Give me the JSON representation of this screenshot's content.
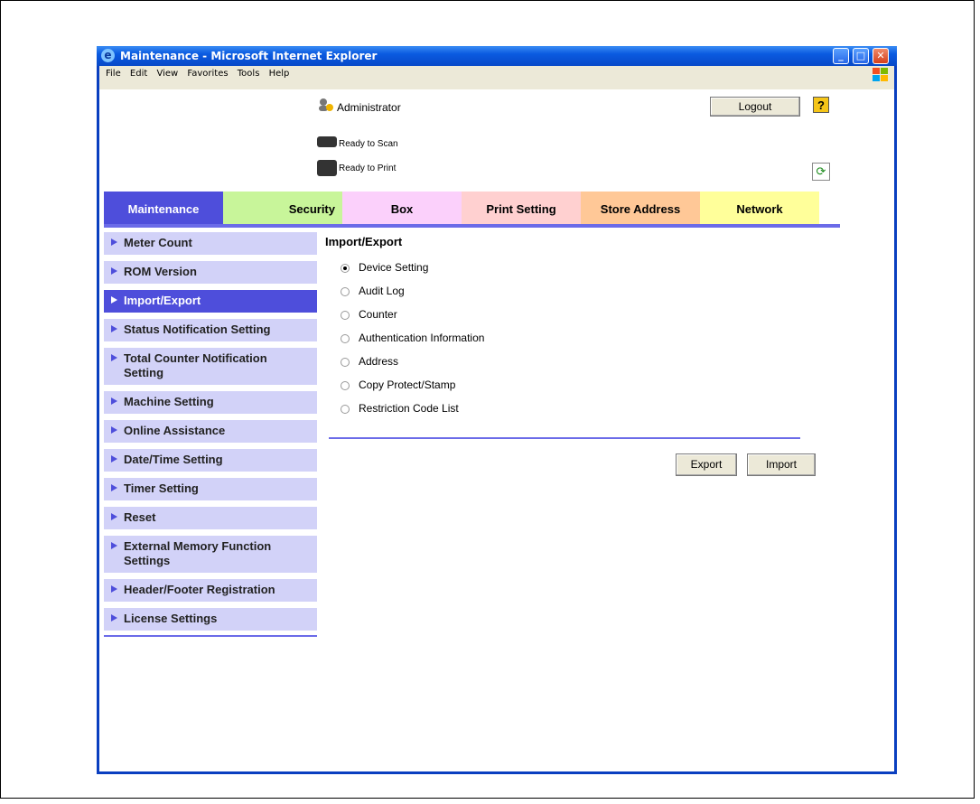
{
  "window": {
    "title": "Maintenance - Microsoft Internet Explorer"
  },
  "menu": [
    "File",
    "Edit",
    "View",
    "Favorites",
    "Tools",
    "Help"
  ],
  "header": {
    "user": "Administrator",
    "logout_label": "Logout",
    "help_label": "?",
    "scan_status": "Ready to Scan",
    "print_status": "Ready to Print"
  },
  "tabs": [
    {
      "label": "Maintenance",
      "color": "#4e4edb",
      "active": true
    },
    {
      "label": "Security",
      "color": "#c8f59a"
    },
    {
      "label": "Box",
      "color": "#fbd0fb"
    },
    {
      "label": "Print Setting",
      "color": "#ffd0d0"
    },
    {
      "label": "Store Address",
      "color": "#ffc897"
    },
    {
      "label": "Network",
      "color": "#ffff9a"
    }
  ],
  "sidebar": {
    "items": [
      {
        "label": "Meter Count"
      },
      {
        "label": "ROM Version"
      },
      {
        "label": "Import/Export",
        "active": true
      },
      {
        "label": "Status Notification Setting"
      },
      {
        "label": "Total Counter Notification Setting"
      },
      {
        "label": "Machine Setting"
      },
      {
        "label": "Online Assistance"
      },
      {
        "label": "Date/Time Setting"
      },
      {
        "label": "Timer Setting"
      },
      {
        "label": "Reset"
      },
      {
        "label": "External Memory Function Settings"
      },
      {
        "label": "Header/Footer Registration"
      },
      {
        "label": "License Settings"
      }
    ]
  },
  "main": {
    "title": "Import/Export",
    "options": [
      {
        "label": "Device Setting",
        "selected": true
      },
      {
        "label": "Audit Log"
      },
      {
        "label": "Counter"
      },
      {
        "label": "Authentication Information"
      },
      {
        "label": "Address"
      },
      {
        "label": "Copy Protect/Stamp"
      },
      {
        "label": "Restriction Code List"
      }
    ],
    "export_label": "Export",
    "import_label": "Import"
  },
  "colors": {
    "accent": "#4e4edb",
    "sidebar_bg": "#d2d2f8",
    "titlebar": "#0a5ae0"
  }
}
